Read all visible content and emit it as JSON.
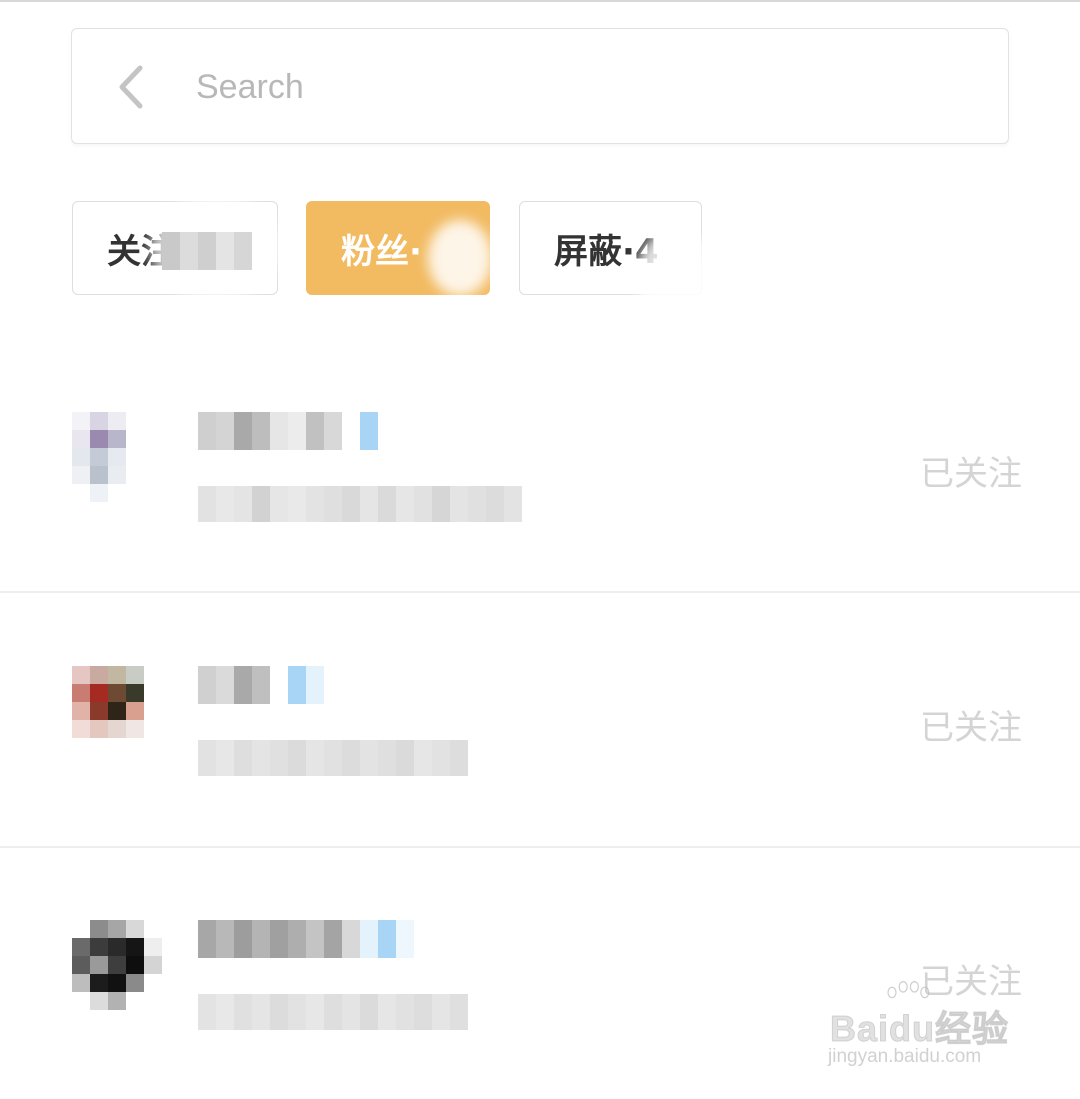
{
  "search": {
    "placeholder": "Search"
  },
  "tabs": [
    {
      "label": "关注",
      "active": false
    },
    {
      "label": "粉丝·",
      "active": true
    },
    {
      "label": "屏蔽·4",
      "active": false
    }
  ],
  "colors": {
    "active_tab": "#f2bb62",
    "follow_text": "#d4d4d4",
    "verified_badge": "#a8d4f5"
  },
  "list": [
    {
      "follow_label": "已关注"
    },
    {
      "follow_label": "已关注"
    },
    {
      "follow_label": "已关注"
    }
  ],
  "watermark": {
    "brand": "Baidu经验",
    "url": "jingyan.baidu.com"
  }
}
